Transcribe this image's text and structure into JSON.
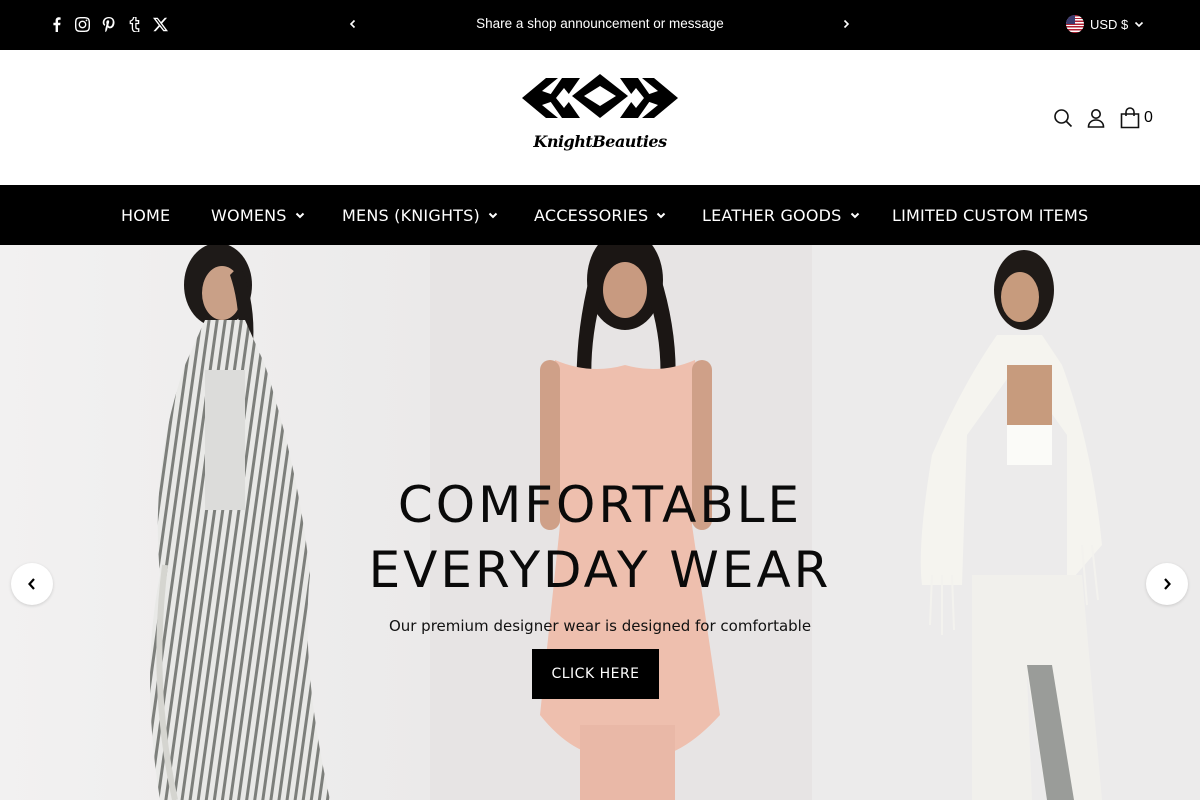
{
  "topbar": {
    "socials": [
      "facebook-icon",
      "instagram-icon",
      "pinterest-icon",
      "tumblr-icon",
      "x-icon"
    ],
    "announcement": "Share a shop announcement or message",
    "currency": "USD $"
  },
  "header": {
    "logo_text": "KnightBeauties",
    "cart_count": "0"
  },
  "nav": {
    "items": [
      {
        "label": "HOME",
        "dropdown": false
      },
      {
        "label": "WOMENS",
        "dropdown": true
      },
      {
        "label": "MENS (KNIGHTS)",
        "dropdown": true
      },
      {
        "label": "ACCESSORIES",
        "dropdown": true
      },
      {
        "label": "LEATHER GOODS",
        "dropdown": true
      },
      {
        "label": "LIMITED CUSTOM ITEMS",
        "dropdown": false
      }
    ]
  },
  "hero": {
    "title_line1": "COMFORTABLE",
    "title_line2": "EVERYDAY WEAR",
    "subtitle": "Our premium designer wear is designed for comfortable",
    "button_label": "CLICK HERE"
  },
  "colors": {
    "bar_background": "#000000",
    "page_background": "#ffffff",
    "hero_background": "#efeded"
  }
}
